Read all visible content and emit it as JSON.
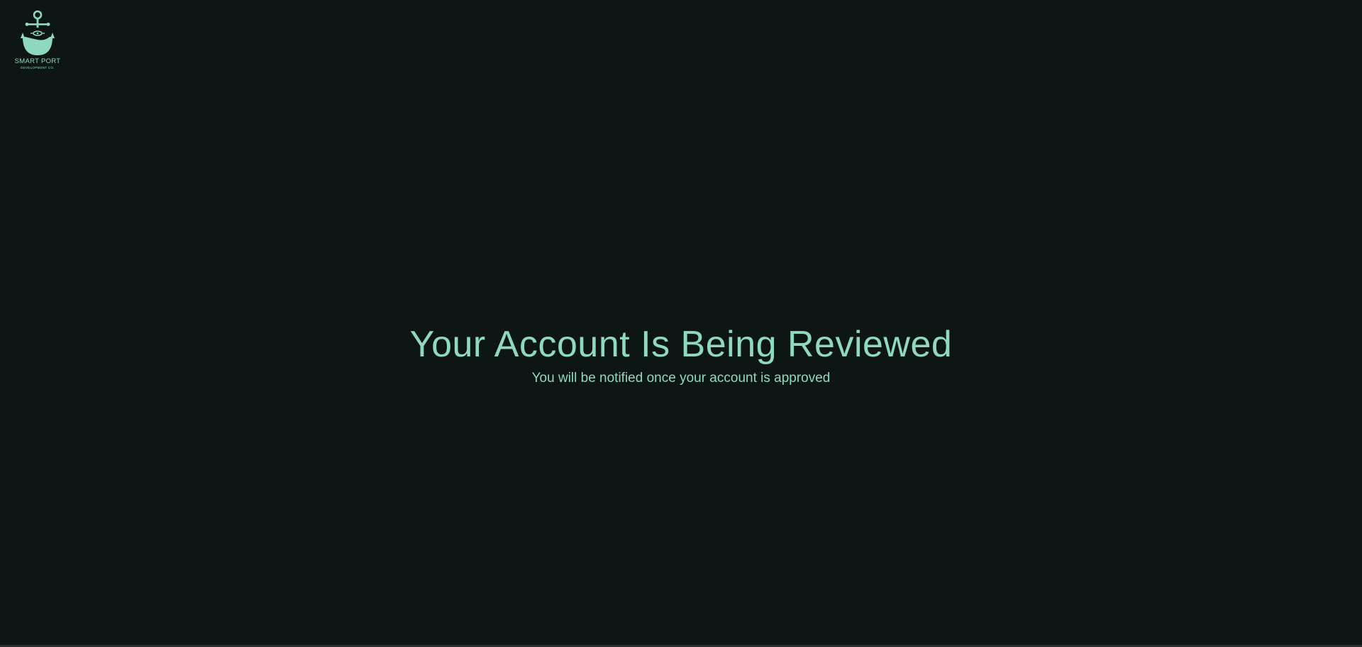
{
  "brand": {
    "name": "SMART PORT",
    "tagline": "DEVELOPMENT CO.",
    "logo_icon": "anchor-icon",
    "accent_color": "#8fd9c0"
  },
  "main": {
    "title": "Your Account Is Being Reviewed",
    "message": "You will be notified once your account is approved"
  },
  "colors": {
    "background": "#0d1614",
    "text": "#8fd9c0"
  }
}
